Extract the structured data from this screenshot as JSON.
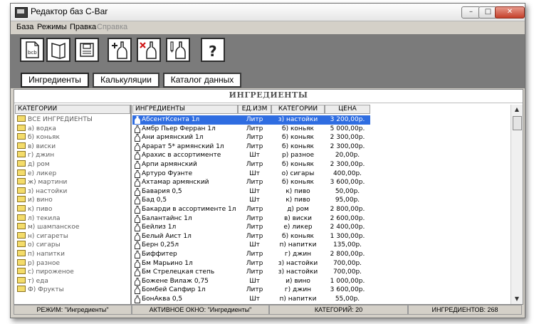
{
  "window": {
    "title": "Редактор баз C-Bar"
  },
  "menu": [
    "База",
    "Режимы",
    "Правка",
    "Справка"
  ],
  "toolbar": {
    "buttons": [
      {
        "name": "bcb-file-icon",
        "label": "bcb"
      },
      {
        "name": "open-book-icon",
        "label": ""
      },
      {
        "name": "save-disk-icon",
        "label": ""
      },
      {
        "name": "add-bottle-icon",
        "label": ""
      },
      {
        "name": "delete-bottle-icon",
        "label": ""
      },
      {
        "name": "edit-bottle-icon",
        "label": ""
      },
      {
        "name": "help-icon",
        "label": "?"
      }
    ]
  },
  "tabs": [
    "Ингредиенты",
    "Калькуляции",
    "Каталог данных"
  ],
  "section_title": "ИНГРЕДИЕНТЫ",
  "categories_header": "КАТЕГОРИИ",
  "categories": [
    "ВСЕ ИНГРЕДИЕНТЫ",
    "а) водка",
    "б) коньяк",
    "в) виски",
    "г) джин",
    "д) ром",
    "е) ликер",
    "ж) мартини",
    "з) настойки",
    "и) вино",
    "к) пиво",
    "л) текила",
    "м) шампанское",
    "н) сигареты",
    "о) сигары",
    "п) напитки",
    "р) разное",
    "с) пироженое",
    "т) еда",
    "Ф) Фрукты"
  ],
  "table": {
    "headers": [
      "ИНГРЕДИЕНТЫ",
      "ЕД.ИЗМ",
      "КАТЕГОРИИ",
      "ЦЕНА"
    ],
    "rows": [
      [
        "АбсентКсента 1л",
        "Литр",
        "з) настойки",
        "3 200,00р."
      ],
      [
        "Амбр Пьер Ферран 1л",
        "Литр",
        "б) коньяк",
        "5 000,00р."
      ],
      [
        "Ани армянский 1л",
        "Литр",
        "б) коньяк",
        "2 300,00р."
      ],
      [
        "Арарат 5* армянский 1л",
        "Литр",
        "б) коньяк",
        "2 300,00р."
      ],
      [
        "Арахис в ассортименте",
        "Шт",
        "р) разное",
        "20,00р."
      ],
      [
        "Арпи армянский",
        "Литр",
        "б) коньяк",
        "2 300,00р."
      ],
      [
        "Артуро Фуэнте",
        "Шт",
        "о) сигары",
        "400,00р."
      ],
      [
        "Ахтамар армянский",
        "Литр",
        "б) коньяк",
        "3 600,00р."
      ],
      [
        "Бавария 0,5",
        "Шт",
        "к) пиво",
        "50,00р."
      ],
      [
        "Бад 0,5",
        "Шт",
        "к) пиво",
        "95,00р."
      ],
      [
        "Бакарди в ассортименте 1л",
        "Литр",
        "д) ром",
        "2 800,00р."
      ],
      [
        "Балантайнс 1л",
        "Литр",
        "в) виски",
        "2 600,00р."
      ],
      [
        "Бейлиз 1л",
        "Литр",
        "е) ликер",
        "2 400,00р."
      ],
      [
        "Белый Аист 1л",
        "Литр",
        "б) коньяк",
        "1 300,00р."
      ],
      [
        "Берн 0,25л",
        "Шт",
        "п) напитки",
        "135,00р."
      ],
      [
        "Биффитер",
        "Литр",
        "г) джин",
        "2 800,00р."
      ],
      [
        "Бм Марьино 1л",
        "Литр",
        "з) настойки",
        "700,00р."
      ],
      [
        "Бм Стрелецкая степь",
        "Литр",
        "з) настойки",
        "700,00р."
      ],
      [
        "Боженe Вилаж 0,75",
        "Шт",
        "и) вино",
        "1 000,00р."
      ],
      [
        "Бомбей Сапфир 1л",
        "Литр",
        "г) джин",
        "3 600,00р."
      ],
      [
        "БонАква 0,5",
        "Шт",
        "п) напитки",
        "55,00р."
      ]
    ]
  },
  "status": [
    "РЕЖИМ: \"Ингредиенты\"",
    "АКТИВНОЕ ОКНО: \"Ингредиенты\"",
    "КАТЕГОРИЙ: 20",
    "ИНГРЕДИЕНТОВ: 268"
  ],
  "colors": {
    "selection": "#2f6de1",
    "toolbar_bg": "#7b7b7b",
    "folder": "#f4dc6a",
    "close": "#c4402a"
  }
}
